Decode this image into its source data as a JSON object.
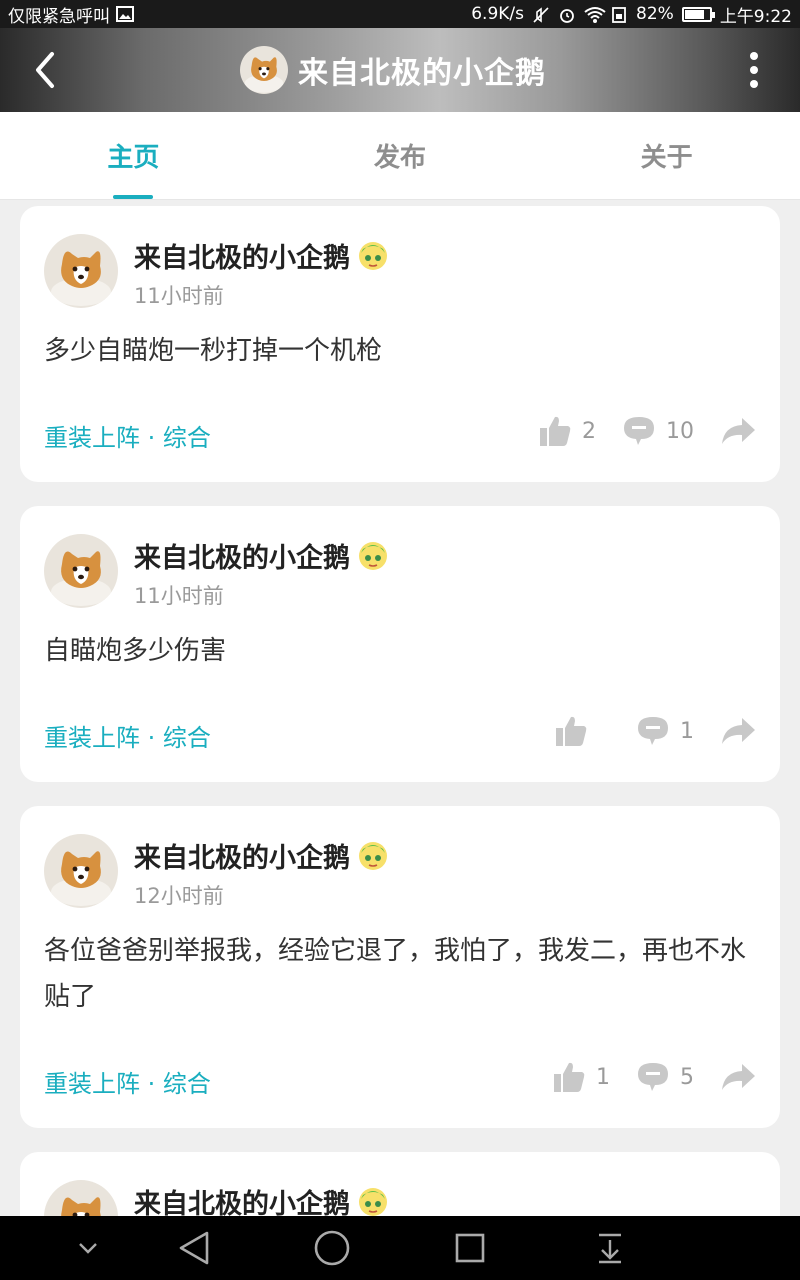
{
  "status_bar": {
    "left_text": "仅限紧急呼叫",
    "net_speed": "6.9K/s",
    "battery": "82%",
    "battery_level": 0.82,
    "time": "上午9:22"
  },
  "header": {
    "title": "来自北极的小企鹅",
    "back_icon": "chevron-left-icon",
    "more_icon": "more-vertical-icon"
  },
  "tabs": [
    {
      "label": "主页",
      "active": true
    },
    {
      "label": "发布",
      "active": false
    },
    {
      "label": "关于",
      "active": false
    }
  ],
  "posts": [
    {
      "author": "来自北极的小企鹅",
      "time": "11小时前",
      "text": "多少自瞄炮一秒打掉一个机枪",
      "tag": "重装上阵 · 综合",
      "likes": "2",
      "comments": "10"
    },
    {
      "author": "来自北极的小企鹅",
      "time": "11小时前",
      "text": "自瞄炮多少伤害",
      "tag": "重装上阵 · 综合",
      "likes": "",
      "comments": "1"
    },
    {
      "author": "来自北极的小企鹅",
      "time": "12小时前",
      "text": "各位爸爸别举报我，经验它退了，我怕了，我发二，再也不水贴了",
      "tag": "重装上阵 · 综合",
      "likes": "1",
      "comments": "5"
    },
    {
      "author": "来自北极的小企鹅"
    }
  ],
  "colors": {
    "accent": "#1aaebf",
    "icon_gray": "#c8c8c8"
  }
}
